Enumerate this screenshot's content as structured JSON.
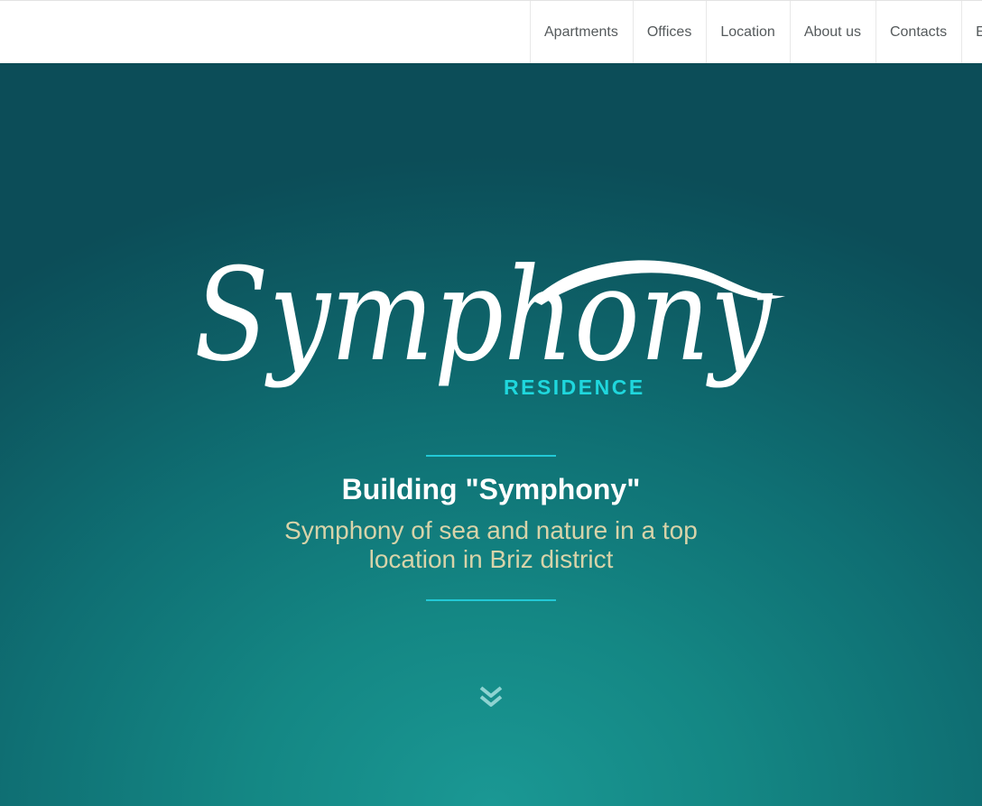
{
  "nav": {
    "items": [
      {
        "label": "Apartments"
      },
      {
        "label": "Offices"
      },
      {
        "label": "Location"
      },
      {
        "label": "About us"
      },
      {
        "label": "Contacts"
      },
      {
        "label": "E"
      }
    ]
  },
  "hero": {
    "logo": {
      "word": "Symphony",
      "sub": "RESIDENCE"
    },
    "title": "Building \"Symphony\"",
    "subtitle": "Symphony of sea and nature in a top location in Briz district",
    "scroll_icon": "double-chevron-down-icon"
  },
  "colors": {
    "accent": "#22c9d6",
    "subtitle": "#d7d3a9",
    "hero_dark": "#0c4d58",
    "hero_light": "#1a9894"
  }
}
